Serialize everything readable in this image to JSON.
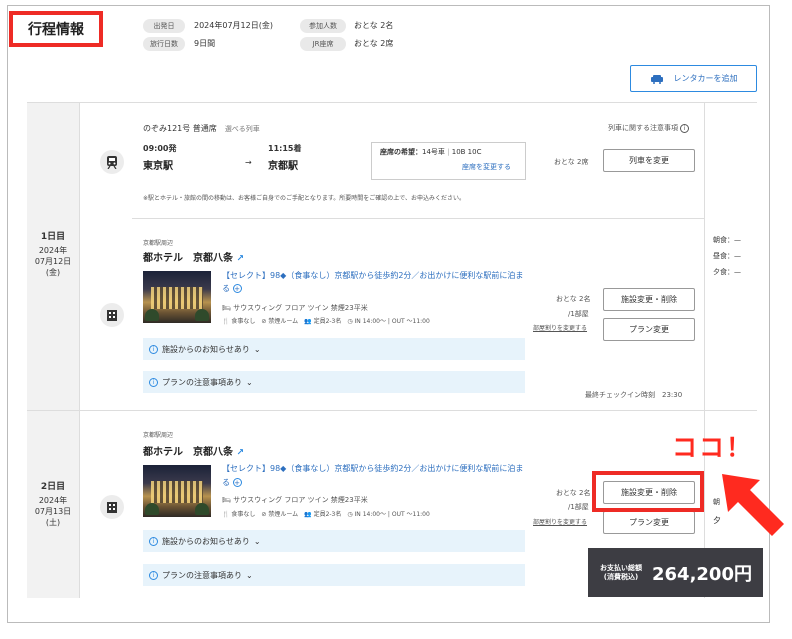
{
  "header": {
    "title": "行程情報",
    "departure_label": "出発日",
    "departure_value": "2024年07月12日(金)",
    "days_label": "旅行日数",
    "days_value": "9日間",
    "participants_label": "参加人数",
    "participants_value": "おとな 2名",
    "jr_label": "JR座席",
    "jr_value": "おとな 2席",
    "rental_button": "レンタカーを追加"
  },
  "day1": {
    "label": "1日目",
    "date_line1": "2024年",
    "date_line2": "07月12日",
    "date_line3": "(金)",
    "train": {
      "name": "のぞみ121号 普通席",
      "selectable": "選べる列車",
      "notice_link": "列車に関する注意事項",
      "dep_time": "09:00発",
      "dep_station": "東京駅",
      "arrow": "→",
      "arr_time": "11:15着",
      "arr_station": "京都駅",
      "seat_label": "座席の希望：",
      "seat_car": "14号車",
      "seat_sep": "|",
      "seat_no": "10B 10C",
      "seat_change": "座席を変更する",
      "pax": "おとな 2席",
      "change_button": "列車を変更",
      "note": "※駅とホテル・旅館の間の移動は、お客様ご自身でのご手配となります。所要時間をご確認の上で、お申込みください。"
    },
    "hotel": {
      "area": "京都駅周辺",
      "name": "都ホテル　京都八条",
      "plan": "【セレクト】98◆（食事なし）京都駅から徒歩約2分／お出かけに便利な駅前に泊ま",
      "plan2": "る",
      "room": "サウスウィング フロア ツイン 禁煙23平米",
      "meal": "食事なし",
      "smoke": "禁煙ルーム",
      "cap": "定員2-3名",
      "checkin": "IN 14:00〜",
      "checkout": "OUT 〜11:00",
      "pax": "おとな 2名",
      "per_room": "/1部屋",
      "room_change": "部屋割りを変更する",
      "change_button": "施設変更・削除",
      "plan_button": "プラン変更",
      "notice1": "施設からのお知らせあり",
      "notice2": "プランの注意事項あり",
      "last_checkin_label": "最終チェックイン時刻",
      "last_checkin_time": "23:30"
    },
    "meals": {
      "breakfast": "朝食：—",
      "lunch": "昼食：—",
      "dinner": "夕食：—"
    }
  },
  "day2": {
    "label": "2日目",
    "date_line1": "2024年",
    "date_line2": "07月13日",
    "date_line3": "(土)",
    "hotel": {
      "area": "京都駅周辺",
      "name": "都ホテル　京都八条",
      "plan": "【セレクト】98◆（食事なし）京都駅から徒歩約2分／お出かけに便利な駅前に泊ま",
      "plan2": "る",
      "room": "サウスウィング フロア ツイン 禁煙23平米",
      "meal": "食事なし",
      "smoke": "禁煙ルーム",
      "cap": "定員2-3名",
      "checkin": "IN 14:00〜",
      "checkout": "OUT 〜11:00",
      "pax": "おとな 2名",
      "per_room": "/1部屋",
      "room_change": "部屋割りを変更する",
      "change_button": "施設変更・削除",
      "plan_button": "プラン変更",
      "notice1": "施設からのお知らせあり",
      "notice2": "プランの注意事項あり"
    },
    "meals_partial": {
      "a": "朝",
      "b": "夕"
    }
  },
  "annotation": {
    "callout": "ココ！"
  },
  "payment": {
    "label1": "お支払い総額",
    "label2": "(消費税込)",
    "amount": "264,200円"
  },
  "colors": {
    "accent_red": "#ee2b25",
    "link_blue": "#2d6fbf",
    "notice_bg": "#e7f3fb",
    "pay_bg": "#3d3d43"
  }
}
